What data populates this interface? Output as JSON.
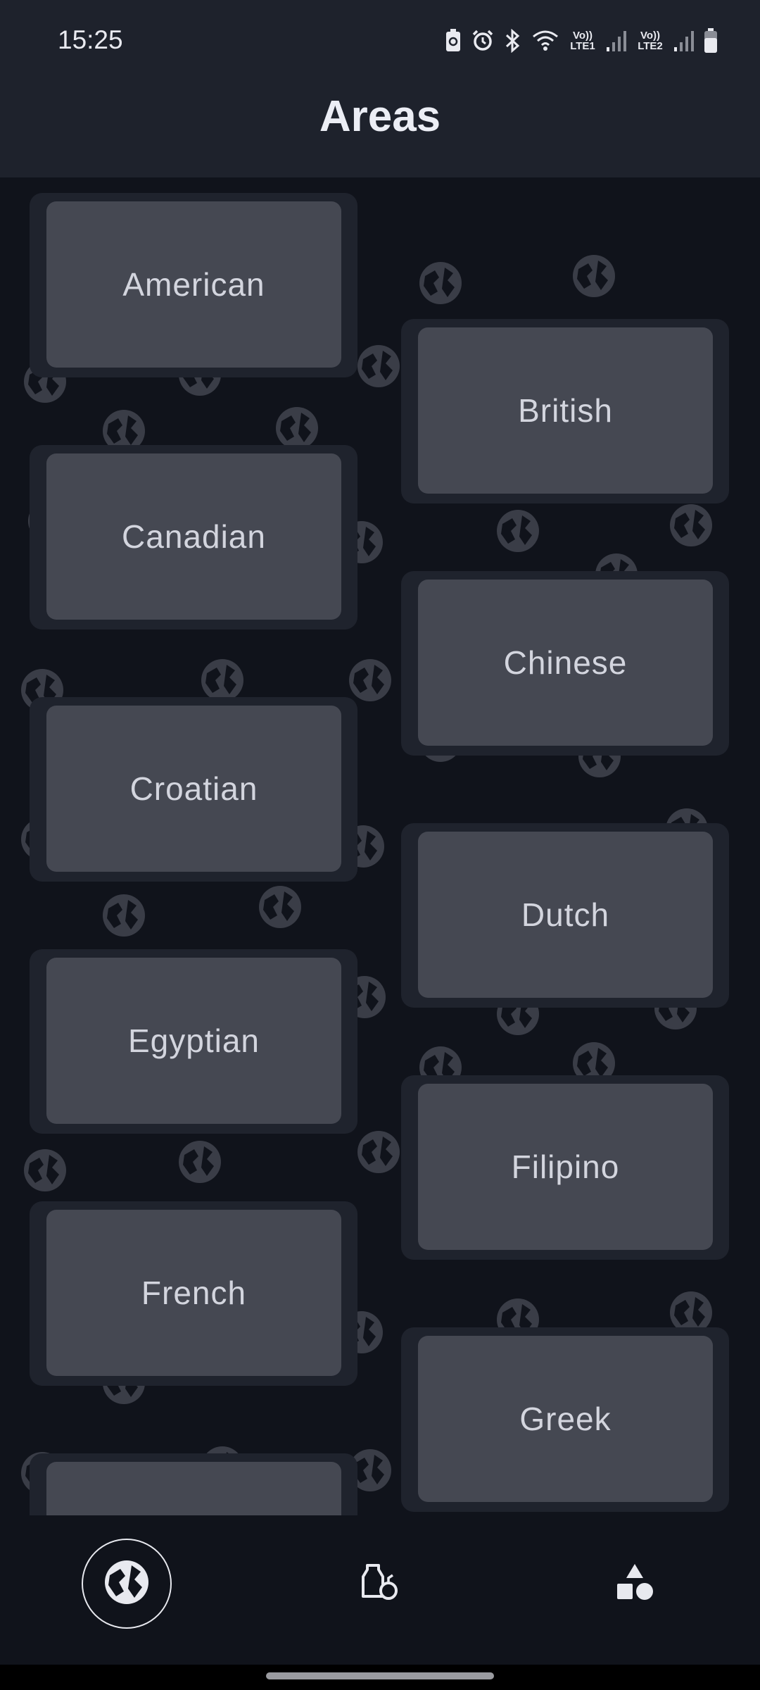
{
  "status_bar": {
    "time": "15:25",
    "sim1_label": "Vo)) LTE1",
    "sim2_label": "Vo)) LTE2",
    "icons": [
      "battery-saver-icon",
      "alarm-icon",
      "bluetooth-icon",
      "wifi-icon",
      "signal-icon",
      "signal-icon",
      "battery-icon"
    ]
  },
  "header": {
    "title": "Areas"
  },
  "areas": [
    {
      "label": "American"
    },
    {
      "label": "British"
    },
    {
      "label": "Canadian"
    },
    {
      "label": "Chinese"
    },
    {
      "label": "Croatian"
    },
    {
      "label": "Dutch"
    },
    {
      "label": "Egyptian"
    },
    {
      "label": "Filipino"
    },
    {
      "label": "French"
    },
    {
      "label": "Greek"
    },
    {
      "label": ""
    }
  ],
  "bottom_nav": {
    "items": [
      {
        "icon": "globe-icon",
        "active": true
      },
      {
        "icon": "ingredients-icon",
        "active": false
      },
      {
        "icon": "categories-icon",
        "active": false
      }
    ]
  },
  "colors": {
    "background": "#10131b",
    "header": "#1e222c",
    "card_outer": "#1f232d",
    "card_inner": "#454852",
    "card_text": "#d3d5de"
  }
}
